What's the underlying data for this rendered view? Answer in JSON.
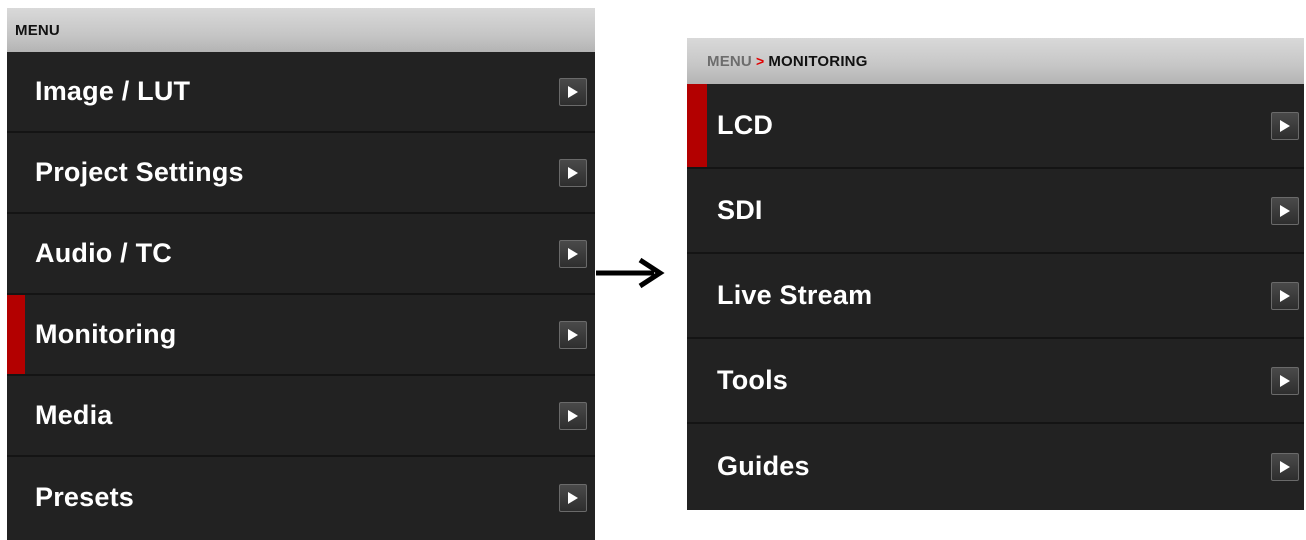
{
  "left_menu": {
    "title": "MENU",
    "items": [
      {
        "label": "Image / LUT",
        "selected": false
      },
      {
        "label": "Project Settings",
        "selected": false
      },
      {
        "label": "Audio / TC",
        "selected": false
      },
      {
        "label": "Monitoring",
        "selected": true
      },
      {
        "label": "Media",
        "selected": false
      },
      {
        "label": "Presets",
        "selected": false
      }
    ]
  },
  "right_menu": {
    "breadcrumb": {
      "parent": "MENU",
      "separator": ">",
      "current": "MONITORING"
    },
    "items": [
      {
        "label": "LCD",
        "selected": true
      },
      {
        "label": "SDI",
        "selected": false
      },
      {
        "label": "Live Stream",
        "selected": false
      },
      {
        "label": "Tools",
        "selected": false
      },
      {
        "label": "Guides",
        "selected": false
      }
    ]
  },
  "icons": {
    "item_chevron": "chevron-right-icon",
    "navigation_arrow": "arrow-right-icon"
  },
  "colors": {
    "panel_bg": "#222222",
    "selection_accent": "#b30000",
    "breadcrumb_separator": "#e00000",
    "header_bg": "#c6c6c6"
  }
}
